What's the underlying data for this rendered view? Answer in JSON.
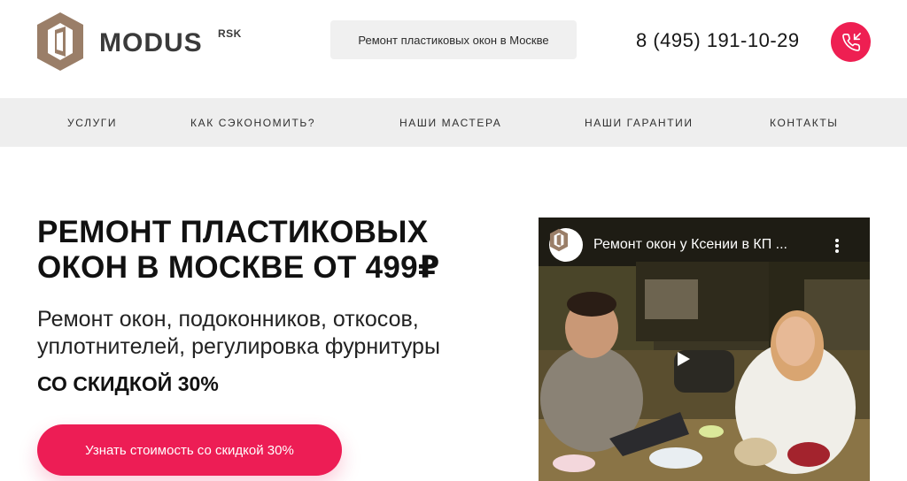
{
  "header": {
    "logo_text": "MODUS",
    "logo_sup": "RSK",
    "search_chip": "Ремонт пластиковых окон в Москве",
    "phone": "8 (495) 191-10-29"
  },
  "nav": {
    "items": [
      {
        "label": "УСЛУГИ"
      },
      {
        "label": "КАК СЭКОНОМИТЬ?"
      },
      {
        "label": "НАШИ МАСТЕРА"
      },
      {
        "label": "НАШИ ГАРАНТИИ"
      },
      {
        "label": "КОНТАКТЫ"
      }
    ]
  },
  "hero": {
    "title_line1": "РЕМОНТ ПЛАСТИКОВЫХ",
    "title_line2": "ОКОН В МОСКВЕ ОТ 499₽",
    "subtitle_line1": "Ремонт окон, подоконников, откосов,",
    "subtitle_line2": "уплотнителей, регулировка фурнитуры",
    "discount": "СО СКИДКОЙ 30%",
    "cta_label": "Узнать стоимость со скидкой 30%"
  },
  "video": {
    "title": "Ремонт окон у Ксении в КП ..."
  },
  "colors": {
    "accent": "#ed1d55",
    "nav_bg": "#eeeeee",
    "logo_brown": "#9a7e68"
  },
  "icons": {
    "call": "phone-incoming-icon",
    "play": "play-icon",
    "menu": "kebab-menu-icon"
  }
}
